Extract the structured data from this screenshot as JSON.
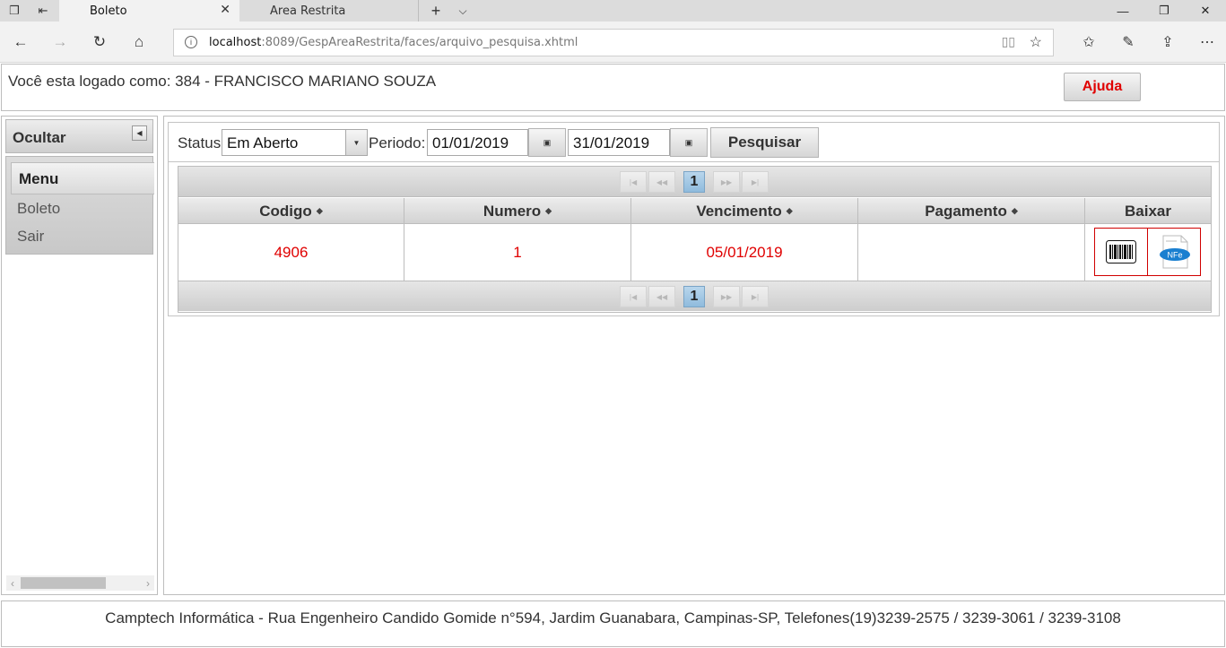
{
  "browser": {
    "tabs": [
      {
        "title": "Boleto",
        "active": true
      },
      {
        "title": "Area Restrita",
        "active": false
      }
    ],
    "url": {
      "host": "localhost",
      "rest": ":8089/GespAreaRestrita/faces/arquivo_pesquisa.xhtml"
    }
  },
  "header": {
    "logged_text": "Você esta logado como: 384 - FRANCISCO MARIANO SOUZA",
    "help_label": "Ajuda"
  },
  "sidebar": {
    "title": "Ocultar",
    "menu_title": "Menu",
    "items": [
      {
        "label": "Boleto"
      },
      {
        "label": "Sair"
      }
    ]
  },
  "filters": {
    "status_label": "Status",
    "status_value": "Em Aberto",
    "period_label": "Periodo:",
    "date_from": "01/01/2019",
    "date_to": "31/01/2019",
    "search_label": "Pesquisar"
  },
  "table": {
    "current_page": "1",
    "columns": [
      "Codigo",
      "Numero",
      "Vencimento",
      "Pagamento",
      "Baixar"
    ],
    "rows": [
      {
        "codigo": "4906",
        "numero": "1",
        "vencimento": "05/01/2019",
        "pagamento": ""
      }
    ],
    "nfe_label": "NFe"
  },
  "footer": {
    "text": "Camptech Informática - Rua Engenheiro Candido Gomide n°594, Jardim Guanabara, Campinas-SP, Telefones(19)3239-2575 / 3239-3061 / 3239-3108"
  },
  "colors": {
    "accent_red": "#e00000",
    "pager_current": "#8fbbdd"
  },
  "icons": [
    "tab-preview-icon",
    "set-aside-tabs-icon",
    "close-icon",
    "new-tab-icon",
    "tab-list-icon",
    "minimize-icon",
    "restore-icon",
    "close-window-icon",
    "back-icon",
    "forward-icon",
    "refresh-icon",
    "home-icon",
    "info-icon",
    "reading-view-icon",
    "favorite-star-icon",
    "favorites-icon",
    "pen-icon",
    "share-icon",
    "more-icon",
    "collapse-icon",
    "dropdown-icon",
    "calendar-icon",
    "first-page-icon",
    "prev-page-icon",
    "next-page-icon",
    "last-page-icon",
    "sort-icon",
    "barcode-icon",
    "nfe-icon"
  ]
}
